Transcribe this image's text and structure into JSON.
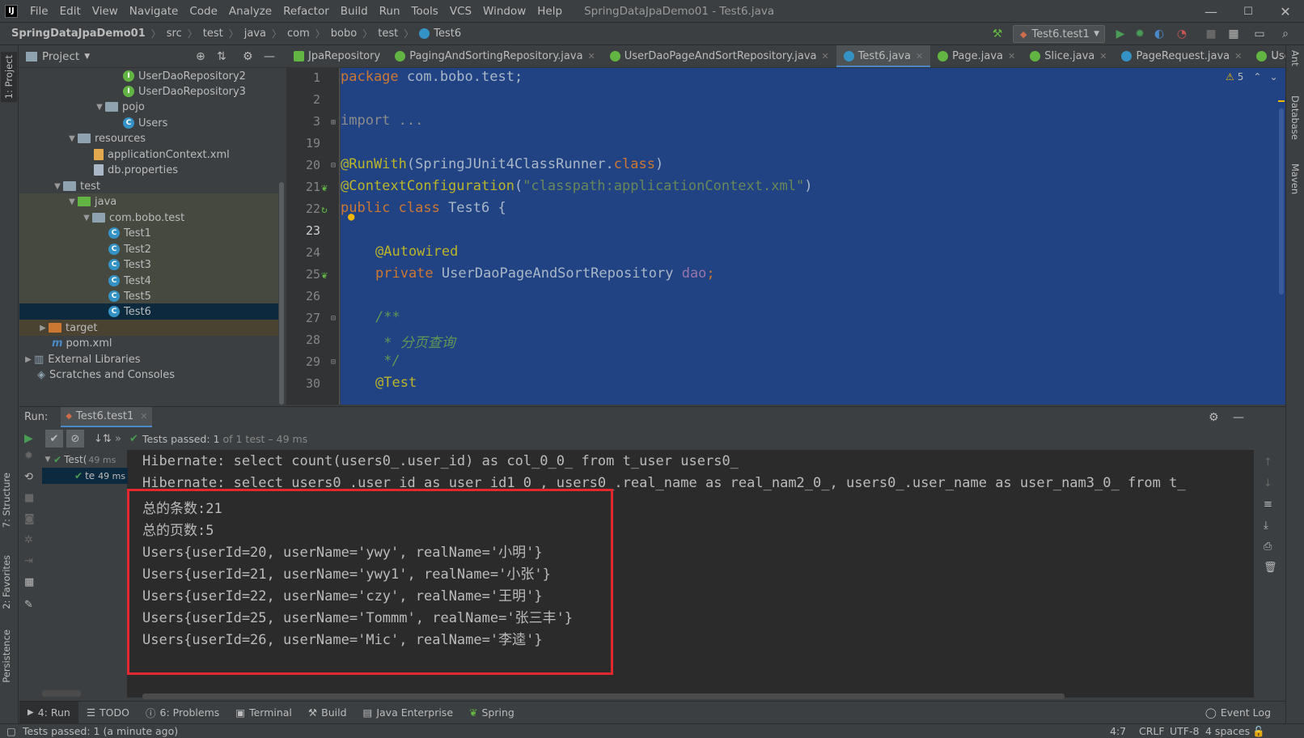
{
  "menubar": {
    "logo": "IJ",
    "items": [
      "File",
      "Edit",
      "View",
      "Navigate",
      "Code",
      "Analyze",
      "Refactor",
      "Build",
      "Run",
      "Tools",
      "VCS",
      "Window",
      "Help"
    ],
    "window_title": "SpringDataJpaDemo01 - Test6.java"
  },
  "breadcrumb": [
    "SpringDataJpaDemo01",
    "src",
    "test",
    "java",
    "com",
    "bobo",
    "test",
    "Test6"
  ],
  "run_config": "Test6.test1",
  "left_stripe": {
    "project": "1: Project",
    "structure": "7: Structure",
    "favorites": "2: Favorites",
    "persistence": "Persistence"
  },
  "right_stripe": {
    "ant": "Ant",
    "database": "Database",
    "maven": "Maven"
  },
  "project_panel": {
    "title": "Project",
    "tree": [
      {
        "label": "UserDaoRepository2"
      },
      {
        "label": "UserDaoRepository3"
      },
      {
        "label": "pojo"
      },
      {
        "label": "Users"
      },
      {
        "label": "resources"
      },
      {
        "label": "applicationContext.xml"
      },
      {
        "label": "db.properties"
      },
      {
        "label": "test"
      },
      {
        "label": "java"
      },
      {
        "label": "com.bobo.test"
      },
      {
        "label": "Test1"
      },
      {
        "label": "Test2"
      },
      {
        "label": "Test3"
      },
      {
        "label": "Test4"
      },
      {
        "label": "Test5"
      },
      {
        "label": "Test6"
      },
      {
        "label": "target"
      },
      {
        "label": "pom.xml"
      },
      {
        "label": "External Libraries"
      },
      {
        "label": "Scratches and Consoles"
      }
    ]
  },
  "editor_tabs": [
    "JpaRepository",
    "PagingAndSortingRepository.java",
    "UserDaoPageAndSortRepository.java",
    "Test6.java",
    "Page.java",
    "Slice.java",
    "PageRequest.java",
    "UserDaoCru"
  ],
  "editor": {
    "warning_count": "5",
    "line_numbers": [
      "1",
      "2",
      "3",
      "19",
      "20",
      "21",
      "22",
      "23",
      "24",
      "25",
      "26",
      "27",
      "28",
      "29",
      "30"
    ],
    "code": {
      "l1_kw": "package",
      "l1_rest": " com.bobo.test;",
      "l3_kw": "import",
      "l3_rest": " ...",
      "l20_ann": "@RunWith",
      "l20_rest": "(SpringJUnit4ClassRunner.",
      "l20_kw": "class",
      "l20_close": ")",
      "l21_ann": "@ContextConfiguration",
      "l21_open": "(",
      "l21_str": "\"classpath:applicationContext.xml\"",
      "l21_close": ")",
      "l22_kw": "public class",
      "l22_rest": " Test6 {",
      "l24_ann": "@Autowired",
      "l25_kw": "private",
      "l25_type": " UserDaoPageAndSortRepository ",
      "l25_fld": "dao",
      "l25_end": ";",
      "l27": "/**",
      "l28": " * 分页查询",
      "l29": " */",
      "l30_ann": "@Test"
    }
  },
  "run_panel": {
    "label": "Run:",
    "tab": "Test6.test1",
    "tests_passed_prefix": "Tests passed:",
    "tests_passed_count": "1",
    "tests_passed_suffix": "of 1 test – 49 ms",
    "tree": [
      {
        "label": "Test(",
        "time": "49 ms"
      },
      {
        "label": "te",
        "time": "49 ms"
      }
    ],
    "console": [
      "Hibernate: select count(users0_.user_id) as col_0_0_ from t_user users0_",
      "Hibernate: select users0_.user_id as user_id1_0_, users0_.real_name as real_nam2_0_, users0_.user_name as user_nam3_0_ from t_",
      "总的条数:21",
      "总的页数:5",
      "Users{userId=20, userName='ywy', realName='小明'}",
      "Users{userId=21, userName='ywy1', realName='小张'}",
      "Users{userId=22, userName='czy', realName='王明'}",
      "Users{userId=25, userName='Tommm', realName='张三丰'}",
      "Users{userId=26, userName='Mic', realName='李逵'}"
    ]
  },
  "bottom_bar": {
    "run": "4: Run",
    "todo": "TODO",
    "problems": "6: Problems",
    "terminal": "Terminal",
    "build": "Build",
    "java_enterprise": "Java Enterprise",
    "spring": "Spring",
    "event_log": "Event Log"
  },
  "status_bar": {
    "message": "Tests passed: 1 (a minute ago)",
    "position": "4:7",
    "line_sep": "CRLF",
    "encoding": "UTF-8",
    "indent": "4 spaces"
  },
  "colors": {
    "selection_bg": "#214283",
    "keyword": "#cc7832",
    "annotation": "#bbb529",
    "string": "#6a8759",
    "highlight_box": "#e0282e",
    "run_green": "#499c54"
  }
}
